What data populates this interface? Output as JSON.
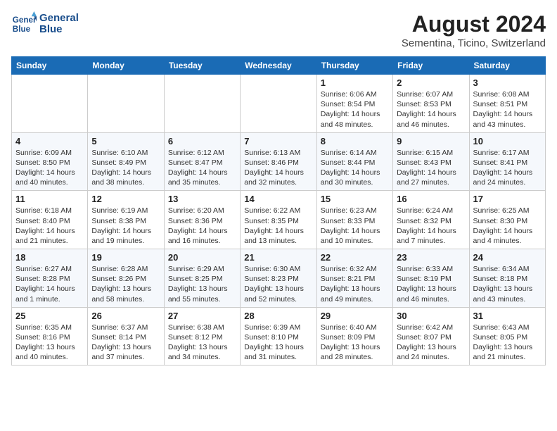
{
  "logo": {
    "line1": "General",
    "line2": "Blue"
  },
  "title": "August 2024",
  "location": "Sementina, Ticino, Switzerland",
  "days_of_week": [
    "Sunday",
    "Monday",
    "Tuesday",
    "Wednesday",
    "Thursday",
    "Friday",
    "Saturday"
  ],
  "weeks": [
    [
      {
        "day": "",
        "info": ""
      },
      {
        "day": "",
        "info": ""
      },
      {
        "day": "",
        "info": ""
      },
      {
        "day": "",
        "info": ""
      },
      {
        "day": "1",
        "info": "Sunrise: 6:06 AM\nSunset: 8:54 PM\nDaylight: 14 hours and 48 minutes."
      },
      {
        "day": "2",
        "info": "Sunrise: 6:07 AM\nSunset: 8:53 PM\nDaylight: 14 hours and 46 minutes."
      },
      {
        "day": "3",
        "info": "Sunrise: 6:08 AM\nSunset: 8:51 PM\nDaylight: 14 hours and 43 minutes."
      }
    ],
    [
      {
        "day": "4",
        "info": "Sunrise: 6:09 AM\nSunset: 8:50 PM\nDaylight: 14 hours and 40 minutes."
      },
      {
        "day": "5",
        "info": "Sunrise: 6:10 AM\nSunset: 8:49 PM\nDaylight: 14 hours and 38 minutes."
      },
      {
        "day": "6",
        "info": "Sunrise: 6:12 AM\nSunset: 8:47 PM\nDaylight: 14 hours and 35 minutes."
      },
      {
        "day": "7",
        "info": "Sunrise: 6:13 AM\nSunset: 8:46 PM\nDaylight: 14 hours and 32 minutes."
      },
      {
        "day": "8",
        "info": "Sunrise: 6:14 AM\nSunset: 8:44 PM\nDaylight: 14 hours and 30 minutes."
      },
      {
        "day": "9",
        "info": "Sunrise: 6:15 AM\nSunset: 8:43 PM\nDaylight: 14 hours and 27 minutes."
      },
      {
        "day": "10",
        "info": "Sunrise: 6:17 AM\nSunset: 8:41 PM\nDaylight: 14 hours and 24 minutes."
      }
    ],
    [
      {
        "day": "11",
        "info": "Sunrise: 6:18 AM\nSunset: 8:40 PM\nDaylight: 14 hours and 21 minutes."
      },
      {
        "day": "12",
        "info": "Sunrise: 6:19 AM\nSunset: 8:38 PM\nDaylight: 14 hours and 19 minutes."
      },
      {
        "day": "13",
        "info": "Sunrise: 6:20 AM\nSunset: 8:36 PM\nDaylight: 14 hours and 16 minutes."
      },
      {
        "day": "14",
        "info": "Sunrise: 6:22 AM\nSunset: 8:35 PM\nDaylight: 14 hours and 13 minutes."
      },
      {
        "day": "15",
        "info": "Sunrise: 6:23 AM\nSunset: 8:33 PM\nDaylight: 14 hours and 10 minutes."
      },
      {
        "day": "16",
        "info": "Sunrise: 6:24 AM\nSunset: 8:32 PM\nDaylight: 14 hours and 7 minutes."
      },
      {
        "day": "17",
        "info": "Sunrise: 6:25 AM\nSunset: 8:30 PM\nDaylight: 14 hours and 4 minutes."
      }
    ],
    [
      {
        "day": "18",
        "info": "Sunrise: 6:27 AM\nSunset: 8:28 PM\nDaylight: 14 hours and 1 minute."
      },
      {
        "day": "19",
        "info": "Sunrise: 6:28 AM\nSunset: 8:26 PM\nDaylight: 13 hours and 58 minutes."
      },
      {
        "day": "20",
        "info": "Sunrise: 6:29 AM\nSunset: 8:25 PM\nDaylight: 13 hours and 55 minutes."
      },
      {
        "day": "21",
        "info": "Sunrise: 6:30 AM\nSunset: 8:23 PM\nDaylight: 13 hours and 52 minutes."
      },
      {
        "day": "22",
        "info": "Sunrise: 6:32 AM\nSunset: 8:21 PM\nDaylight: 13 hours and 49 minutes."
      },
      {
        "day": "23",
        "info": "Sunrise: 6:33 AM\nSunset: 8:19 PM\nDaylight: 13 hours and 46 minutes."
      },
      {
        "day": "24",
        "info": "Sunrise: 6:34 AM\nSunset: 8:18 PM\nDaylight: 13 hours and 43 minutes."
      }
    ],
    [
      {
        "day": "25",
        "info": "Sunrise: 6:35 AM\nSunset: 8:16 PM\nDaylight: 13 hours and 40 minutes."
      },
      {
        "day": "26",
        "info": "Sunrise: 6:37 AM\nSunset: 8:14 PM\nDaylight: 13 hours and 37 minutes."
      },
      {
        "day": "27",
        "info": "Sunrise: 6:38 AM\nSunset: 8:12 PM\nDaylight: 13 hours and 34 minutes."
      },
      {
        "day": "28",
        "info": "Sunrise: 6:39 AM\nSunset: 8:10 PM\nDaylight: 13 hours and 31 minutes."
      },
      {
        "day": "29",
        "info": "Sunrise: 6:40 AM\nSunset: 8:09 PM\nDaylight: 13 hours and 28 minutes."
      },
      {
        "day": "30",
        "info": "Sunrise: 6:42 AM\nSunset: 8:07 PM\nDaylight: 13 hours and 24 minutes."
      },
      {
        "day": "31",
        "info": "Sunrise: 6:43 AM\nSunset: 8:05 PM\nDaylight: 13 hours and 21 minutes."
      }
    ]
  ]
}
